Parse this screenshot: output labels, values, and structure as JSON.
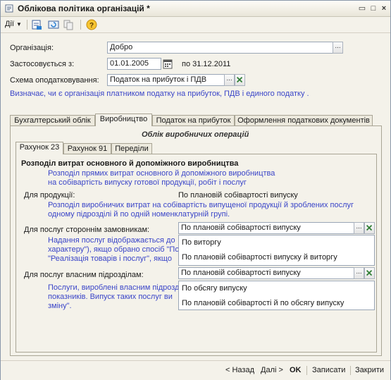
{
  "window": {
    "title": "Облікова політика організацій *",
    "controls": [
      "▭",
      "□",
      "×"
    ]
  },
  "toolbar": {
    "actions_label": "Дії"
  },
  "form": {
    "org_label": "Організація:",
    "org_value": "Добро",
    "applies_label": "Застосовується з:",
    "date_value": "01.01.2005",
    "until_text": "по 31.12.2011",
    "tax_scheme_label": "Схема оподатковування:",
    "tax_scheme_value": "Податок на прибуток і ПДВ",
    "tax_scheme_note": "Визначає, чи є організація платником податку на прибуток, ПДВ і единого податку ."
  },
  "tabs": [
    "Бухгалтерський облік",
    "Виробництво",
    "Податок на прибуток",
    "Оформлення податкових документів"
  ],
  "section_title": "Облік виробничих операцій",
  "subtabs": [
    "Рахунок 23",
    "Рахунок 91",
    "Переділи"
  ],
  "content": {
    "heading": "Розподіл витрат основного й допоміжного виробництва",
    "heading_note": [
      "Розподіл прямих витрат основного й допоміжного виробництва",
      "на собівартість випуску готової продукції, робіт і послуг"
    ],
    "products_label": "Для продукції:",
    "products_value": "По плановій собівартості випуску",
    "products_note": [
      "Розподіл виробничих витрат на собівартість випущеної продукції й зроблених послуг",
      "одному підрозділі й по одній номенклатурній групі."
    ],
    "external_label": "Для послуг стороннім замовникам:",
    "external_value": "По плановій собівартості випуску",
    "external_note": [
      "Надання послуг відображається до",
      "характеру\"), якщо обрано спосіб \"По",
      "\"Реалізація товарів і послуг\", якщо"
    ],
    "external_options": [
      "По виторгу",
      "По плановій собівартості випуску й виторгу"
    ],
    "internal_label": "Для послуг власним підрозділам:",
    "internal_value": "По плановій собівартості випуску",
    "internal_note": [
      "Послуги, вироблені власним підрозд",
      "показників. Випуск таких послуг ви",
      "зміну\"."
    ],
    "internal_options": [
      "По обсягу випуску",
      "По плановій собівартості й по обсягу випуску"
    ]
  },
  "footer": {
    "back": "< Назад",
    "next": "Далі >",
    "ok": "OK",
    "save": "Записати",
    "close": "Закрити"
  },
  "colors": {
    "note_text": "#3a45c8",
    "accent_green": "#2e7d32"
  }
}
